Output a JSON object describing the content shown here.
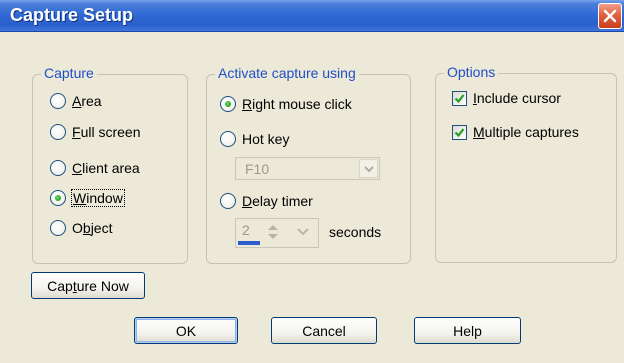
{
  "window": {
    "title": "Capture Setup"
  },
  "capture_group": {
    "legend": "Capture",
    "options": [
      {
        "key": "A",
        "rest": "rea",
        "selected": false
      },
      {
        "key": "F",
        "rest": "ull screen",
        "selected": false
      },
      {
        "key": "C",
        "rest": "lient area",
        "selected": false
      },
      {
        "key": "W",
        "rest": "indow",
        "selected": true
      },
      {
        "pre": "O",
        "key": "b",
        "rest": "ject",
        "selected": false
      }
    ]
  },
  "activate_group": {
    "legend": "Activate capture using",
    "right_click": {
      "key": "R",
      "rest": "ight mouse click",
      "selected": true
    },
    "hot_key": {
      "label": "Hot key",
      "selected": false
    },
    "hot_key_value": "F10",
    "delay_timer": {
      "key": "D",
      "rest": "elay timer",
      "selected": false
    },
    "delay_value": "2",
    "seconds_label": "seconds"
  },
  "options_group": {
    "legend": "Options",
    "include_cursor": {
      "key": "I",
      "rest": "nclude cursor",
      "checked": true
    },
    "multiple_captures": {
      "key": "M",
      "rest": "ultiple captures",
      "checked": true
    }
  },
  "buttons": {
    "capture_now": {
      "pre": "Cap",
      "key": "t",
      "rest": "ure Now"
    },
    "ok": "OK",
    "cancel": "Cancel",
    "help": "Help"
  },
  "colors": {
    "group_label": "#1f4fc6",
    "title_bar": "#2f68d4",
    "radio_dot": "#21a121",
    "checkmark": "#21a121"
  },
  "icons": {
    "close": "close-icon",
    "combo_dropdown": "chevron-down-icon",
    "spin": "spin-arrows-icon"
  }
}
